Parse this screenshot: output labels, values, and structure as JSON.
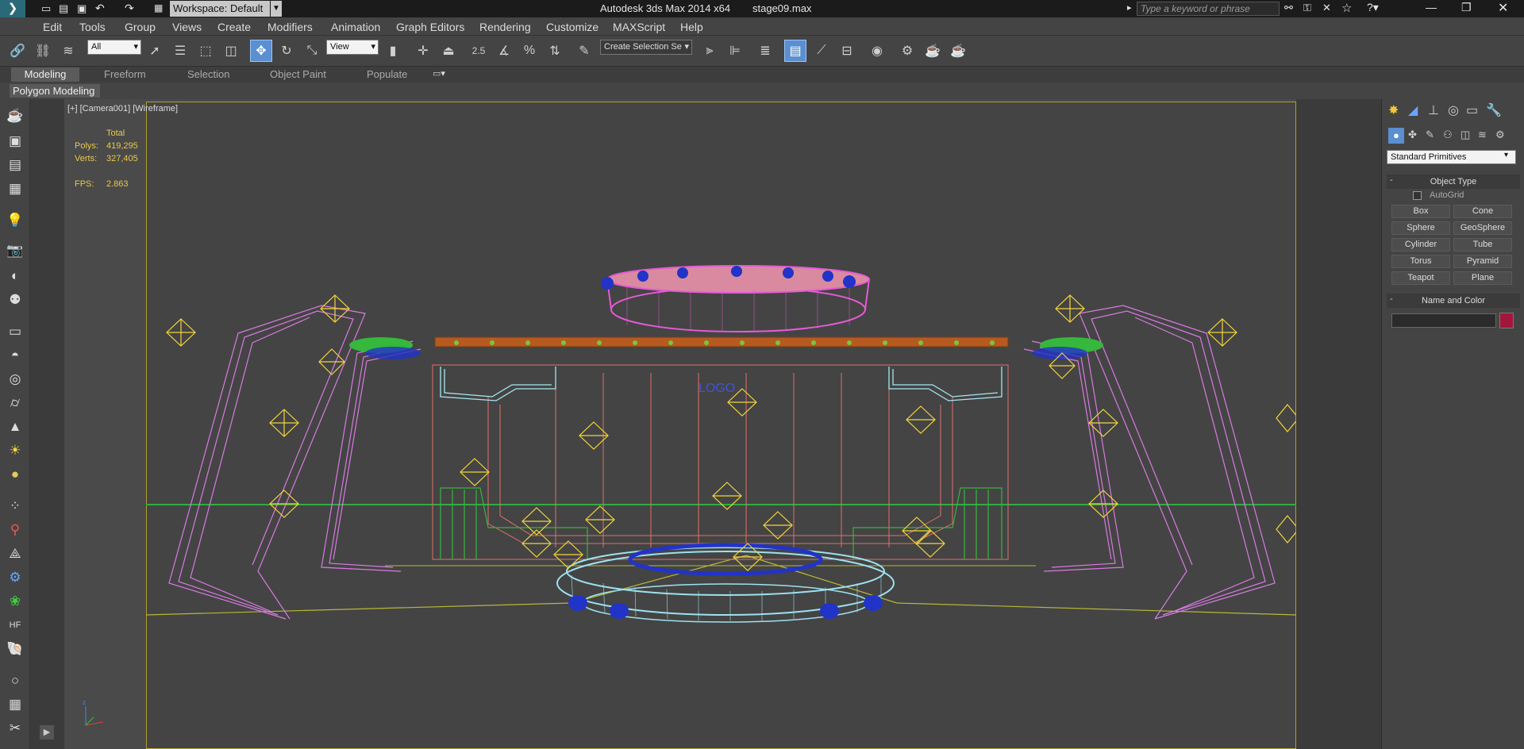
{
  "titlebar": {
    "workspace": "Workspace: Default",
    "title": "Autodesk 3ds Max  2014 x64",
    "file": "stage09.max",
    "search_placeholder": "Type a keyword or phrase"
  },
  "menus": [
    "Edit",
    "Tools",
    "Group",
    "Views",
    "Create",
    "Modifiers",
    "Animation",
    "Graph Editors",
    "Rendering",
    "Customize",
    "MAXScript",
    "Help"
  ],
  "toolbar": {
    "filter_value": "All",
    "refcoord_value": "View",
    "snap_label": "2.5",
    "named_selection_value": "Create Selection Se"
  },
  "ribbon": {
    "tabs": [
      "Modeling",
      "Freeform",
      "Selection",
      "Object Paint",
      "Populate"
    ],
    "panel_label": "Polygon Modeling"
  },
  "viewport": {
    "label": "[+] [Camera001] [Wireframe]",
    "stats_total_label": "Total",
    "polys_label": "Polys:",
    "polys_value": "419,295",
    "verts_label": "Verts:",
    "verts_value": "327,405",
    "fps_label": "FPS:",
    "fps_value": "2.863",
    "logo_text": "LOGO"
  },
  "command_panel": {
    "category": "Standard Primitives",
    "object_type_title": "Object Type",
    "autogrid_label": "AutoGrid",
    "buttons": [
      "Box",
      "Cone",
      "Sphere",
      "GeoSphere",
      "Cylinder",
      "Tube",
      "Torus",
      "Pyramid",
      "Teapot",
      "Plane"
    ],
    "name_color_title": "Name and Color",
    "color": "#a3163b"
  }
}
